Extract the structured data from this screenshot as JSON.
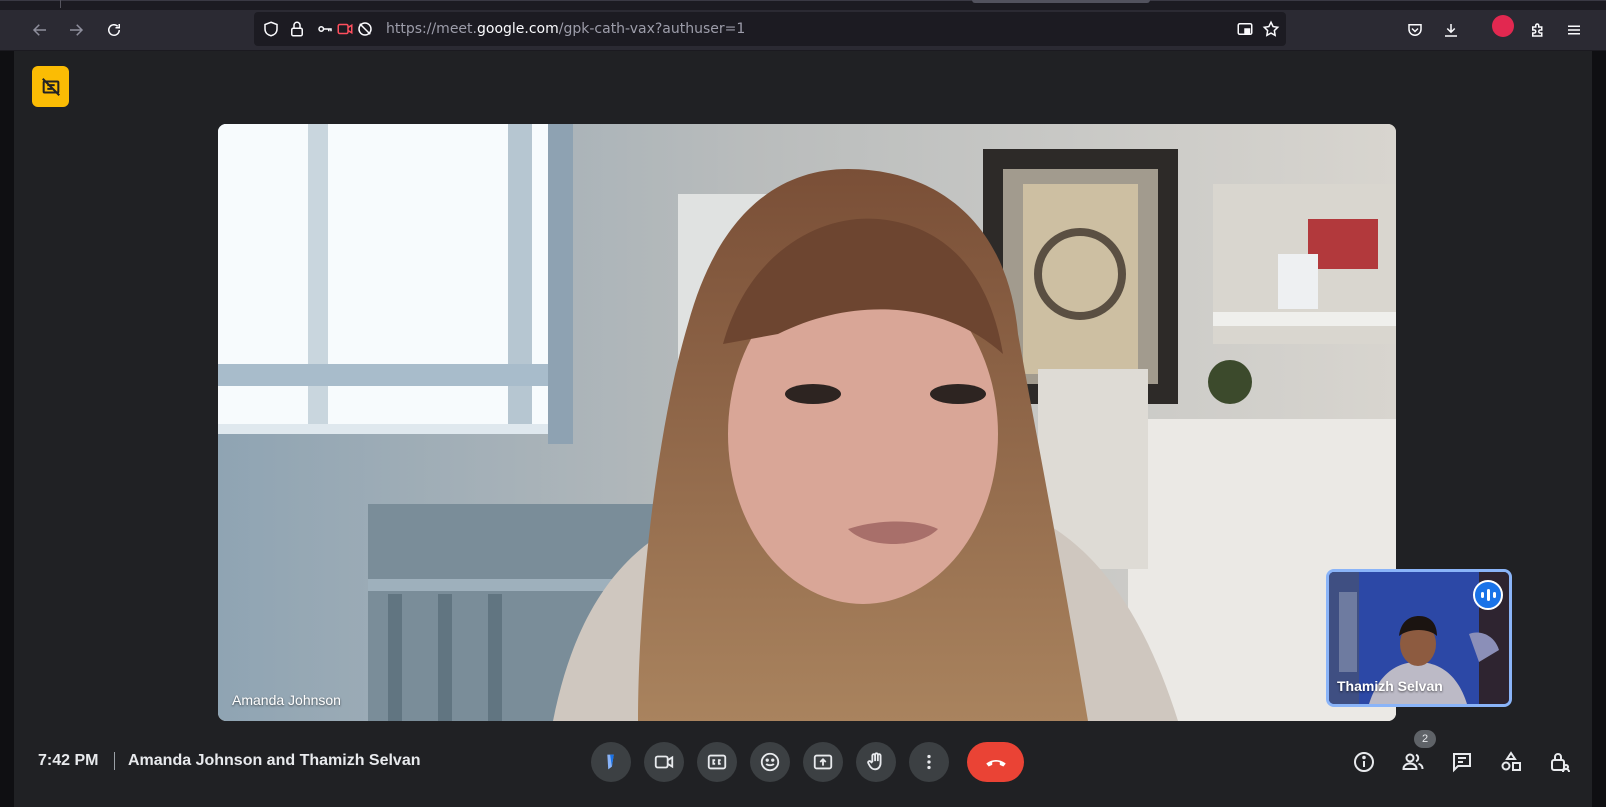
{
  "browser": {
    "url_prefix": "https://meet.",
    "url_domain": "google.com",
    "url_path": "/gpk-cath-vax?authuser=1"
  },
  "meeting": {
    "time": "7:42 PM",
    "title": "Amanda Johnson and Thamizh Selvan",
    "participant_count": "2"
  },
  "participants": {
    "main_name": "Amanda Johnson",
    "self_name": "Thamizh Selvan"
  },
  "icons": {
    "back": "back-arrow-icon",
    "forward": "forward-arrow-icon",
    "reload": "reload-icon",
    "shield": "shield-icon",
    "lock": "lock-icon",
    "permissions": "permissions-icon",
    "camera_blocked": "camera-blocked-icon",
    "tracking_off": "tracking-off-icon",
    "pip": "picture-in-picture-icon",
    "bookmark": "star-icon",
    "pocket": "pocket-icon",
    "download": "download-icon",
    "extensions": "puzzle-icon",
    "menu": "hamburger-menu-icon"
  },
  "colors": {
    "end_call": "#ea4335",
    "active_speaker_border": "#8ab4f8",
    "no_camera_badge": "#fbbc04"
  }
}
